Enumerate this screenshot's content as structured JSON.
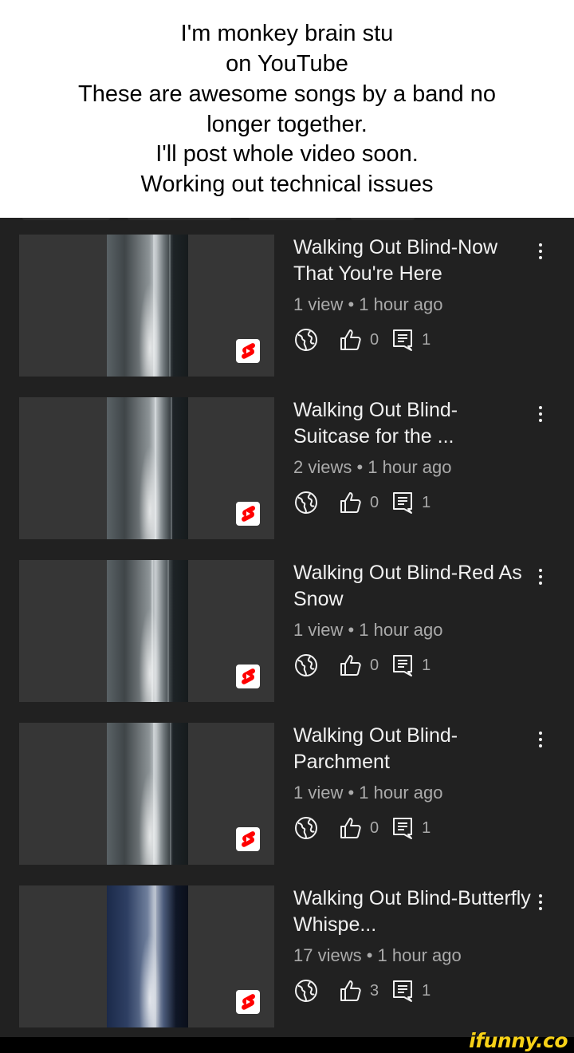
{
  "caption": {
    "lines": [
      "I'm monkey brain stu",
      "on YouTube",
      "These are awesome songs by a band no",
      "longer together.",
      "I'll post whole video soon.",
      "Working out technical issues"
    ]
  },
  "videos": [
    {
      "title": "Walking Out Blind-Now That You're Here",
      "meta": "1 view • 1 hour ago",
      "likes": "0",
      "comments": "1"
    },
    {
      "title": "Walking Out Blind-Suitcase for the ...",
      "meta": "2 views • 1 hour ago",
      "likes": "0",
      "comments": "1"
    },
    {
      "title": "Walking Out Blind-Red As Snow",
      "meta": "1 view • 1 hour ago",
      "likes": "0",
      "comments": "1"
    },
    {
      "title": "Walking Out Blind-Parchment",
      "meta": "1 view • 1 hour ago",
      "likes": "0",
      "comments": "1"
    },
    {
      "title": "Walking Out Blind-Butterfly Whispe...",
      "meta": "17 views • 1 hour ago",
      "likes": "3",
      "comments": "1"
    }
  ],
  "icons": {
    "visibility": "globe-icon",
    "likes": "thumbs-up-icon",
    "comments": "comment-icon",
    "more": "more-vert-icon",
    "badge": "shorts-icon"
  },
  "colors": {
    "background": "#212121",
    "thumbnail": "#363636",
    "title": "#f1f1f1",
    "meta": "#aaaaaa",
    "shorts_red": "#ff0000",
    "watermark": "#f7d117"
  },
  "watermark": "ifunny.co"
}
